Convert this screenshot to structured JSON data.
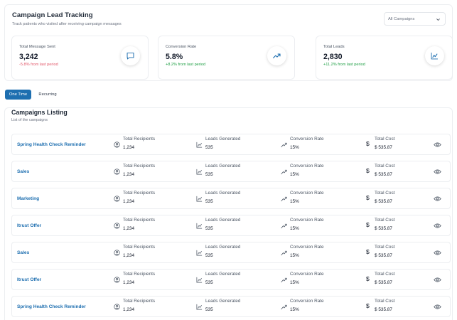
{
  "header": {
    "title": "Campaign Lead Tracking",
    "subtitle": "Track patients who visited after receiving campaign messages",
    "campaign_filter": "All Campaigns"
  },
  "stats": [
    {
      "label": "Total Message Sent",
      "value": "3,242",
      "change": "-5.8% from last period",
      "trend": "negative",
      "icon": "message-icon"
    },
    {
      "label": "Conversion Rate",
      "value": "5.8%",
      "change": "+8.2% from last period",
      "trend": "positive",
      "icon": "trending-up-icon"
    },
    {
      "label": "Total Leads",
      "value": "2,830",
      "change": "+11.2% from last period",
      "trend": "positive",
      "icon": "chart-line-icon"
    }
  ],
  "tabs": {
    "one_time": "One Time",
    "recurring": "Recurring"
  },
  "listing": {
    "title": "Campaigns Listing",
    "subtitle": "List of the campaigns",
    "labels": {
      "recipients": "Total Recipients",
      "leads": "Leads Generated",
      "conversion": "Conversion Rate",
      "cost": "Total Cost",
      "dollar_symbol": "$"
    },
    "rows": [
      {
        "name": "Spring Health Check Reminder",
        "recipients": "1,234",
        "leads": "535",
        "conversion": "15%",
        "cost": "$ 535.87"
      },
      {
        "name": "Sales",
        "recipients": "1,234",
        "leads": "535",
        "conversion": "15%",
        "cost": "$ 535.87"
      },
      {
        "name": "Marketing",
        "recipients": "1,234",
        "leads": "535",
        "conversion": "15%",
        "cost": "$ 535.87"
      },
      {
        "name": "Itrust Offer",
        "recipients": "1,234",
        "leads": "535",
        "conversion": "15%",
        "cost": "$ 535.87"
      },
      {
        "name": "Sales",
        "recipients": "1,234",
        "leads": "535",
        "conversion": "15%",
        "cost": "$ 535.87"
      },
      {
        "name": "Itrust Offer",
        "recipients": "1,234",
        "leads": "535",
        "conversion": "15%",
        "cost": "$ 535.87"
      },
      {
        "name": "Spring Health Check Reminder",
        "recipients": "1,234",
        "leads": "535",
        "conversion": "15%",
        "cost": "$ 535.87"
      }
    ]
  },
  "colors": {
    "accent": "#1e6fb0",
    "negative": "#e2586a",
    "positive": "#22a047"
  }
}
